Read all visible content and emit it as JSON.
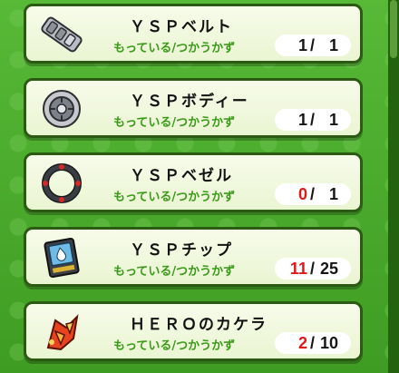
{
  "caption_have": "もっている",
  "caption_sep": "/",
  "caption_need": "つかうかず",
  "items": [
    {
      "name": "ＹＳＰベルト",
      "icon": "belt-icon",
      "have": "1",
      "need": "1",
      "short": false
    },
    {
      "name": "ＹＳＰボディー",
      "icon": "body-disc-icon",
      "have": "1",
      "need": "1",
      "short": false
    },
    {
      "name": "ＹＳＰベゼル",
      "icon": "bezel-ring-icon",
      "have": "0",
      "need": "1",
      "short": true
    },
    {
      "name": "ＹＳＰチップ",
      "icon": "chip-card-icon",
      "have": "11",
      "need": "25",
      "short": true
    },
    {
      "name": "ＨＥＲＯのカケラ",
      "icon": "hero-fragment-icon",
      "have": "2",
      "need": "10",
      "short": true
    }
  ],
  "colors": {
    "short": "#e01818",
    "caption": "#3a9a18",
    "border": "#2b5a12"
  }
}
